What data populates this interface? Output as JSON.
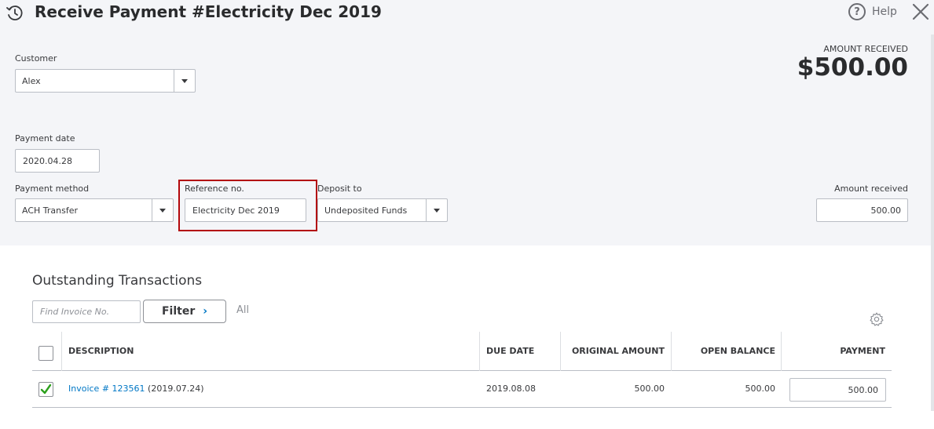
{
  "header": {
    "title": "Receive Payment #Electricity Dec 2019",
    "help_label": "Help",
    "help_glyph": "?"
  },
  "customer": {
    "label": "Customer",
    "value": "Alex"
  },
  "amount_received_header": {
    "caption": "AMOUNT RECEIVED",
    "value": "$500.00"
  },
  "payment_date": {
    "label": "Payment date",
    "value": "2020.04.28"
  },
  "payment_method": {
    "label": "Payment method",
    "value": "ACH Transfer"
  },
  "reference": {
    "label": "Reference no.",
    "value": "Electricity Dec 2019",
    "highlight_color": "#b3070b"
  },
  "deposit_to": {
    "label": "Deposit to",
    "value": "Undeposited Funds"
  },
  "amount_received_field": {
    "label": "Amount received",
    "value": "500.00"
  },
  "outstanding": {
    "title": "Outstanding Transactions",
    "find_placeholder": "Find Invoice No.",
    "filter_label": "Filter",
    "filter_chevron": "›",
    "all_label": "All",
    "columns": {
      "description": "DESCRIPTION",
      "due_date": "DUE DATE",
      "original_amount": "ORIGINAL AMOUNT",
      "open_balance": "OPEN BALANCE",
      "payment": "PAYMENT"
    },
    "rows": [
      {
        "checked": true,
        "invoice_link": "Invoice # 123561",
        "invoice_date": "(2019.07.24)",
        "due_date": "2019.08.08",
        "original_amount": "500.00",
        "open_balance": "500.00",
        "payment": "500.00"
      }
    ]
  },
  "colors": {
    "link": "#0077c5",
    "check": "#2ca01c",
    "panel_bg": "#f4f5f8"
  },
  "icons": {
    "title": "history-clock-icon",
    "help": "help-circle-icon",
    "close": "close-icon",
    "settings": "gear-icon",
    "check": "checkmark-icon",
    "dropdown": "caret-down-icon"
  }
}
